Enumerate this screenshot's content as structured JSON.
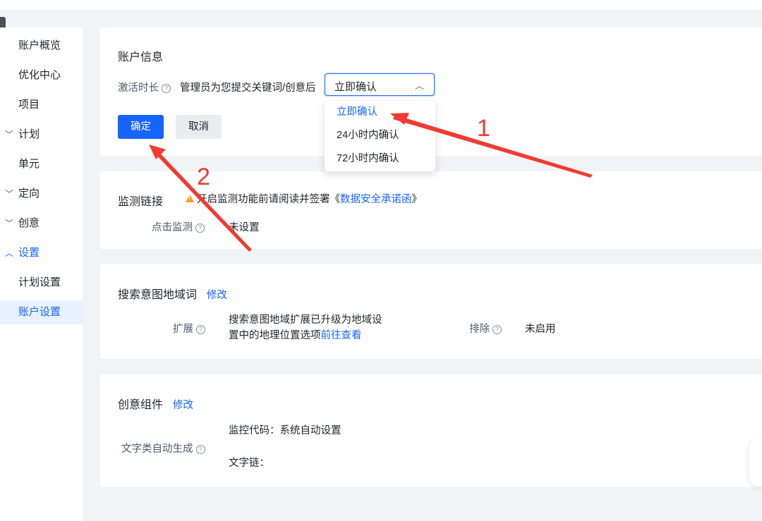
{
  "sidebar": {
    "items": [
      {
        "label": "账户概览",
        "chevron": ""
      },
      {
        "label": "优化中心",
        "chevron": ""
      },
      {
        "label": "项目",
        "chevron": ""
      },
      {
        "label": "计划",
        "chevron": "﹀"
      },
      {
        "label": "单元",
        "chevron": ""
      },
      {
        "label": "定向",
        "chevron": "﹀"
      },
      {
        "label": "创意",
        "chevron": "﹀"
      },
      {
        "label": "设置",
        "chevron": "︿"
      },
      {
        "label": "计划设置",
        "chevron": ""
      },
      {
        "label": "账户设置",
        "chevron": ""
      }
    ],
    "expanded": "设置",
    "active": "账户设置"
  },
  "account_info": {
    "title": "账户信息",
    "activation_label": "激活时长",
    "desc": "管理员为您提交关键词/创意后",
    "select_value": "立即确认",
    "options": [
      "立即确认",
      "24小时内确认",
      "72小时内确认"
    ],
    "selected_option": "立即确认",
    "ok_label": "确定",
    "cancel_label": "取消"
  },
  "monitor": {
    "title": "监测链接",
    "warning_prefix": "开启监测功能前请阅读并签署《",
    "warning_link": "数据安全承诺函",
    "warning_suffix": "》",
    "click_label": "点击监测",
    "click_value": "未设置"
  },
  "search_intent": {
    "title": "搜索意图地域词",
    "edit_label": "修改",
    "extend_label": "扩展",
    "extend_line1": "搜索意图地域扩展已升级为地域设",
    "extend_line2": "置中的地理位置选项",
    "extend_link": "前往查看",
    "exclude_label": "排除",
    "exclude_value": "未启用"
  },
  "creative": {
    "title": "创意组件",
    "edit_label": "修改",
    "auto_label": "文字类自动生成",
    "monitor_code": "监控代码：系统自动设置",
    "text_link": "文字链："
  },
  "annotations": {
    "label1": "1",
    "label2": "2",
    "color": "#f23a32"
  },
  "colors": {
    "primary": "#1664ff",
    "warning": "#ff9d00"
  }
}
